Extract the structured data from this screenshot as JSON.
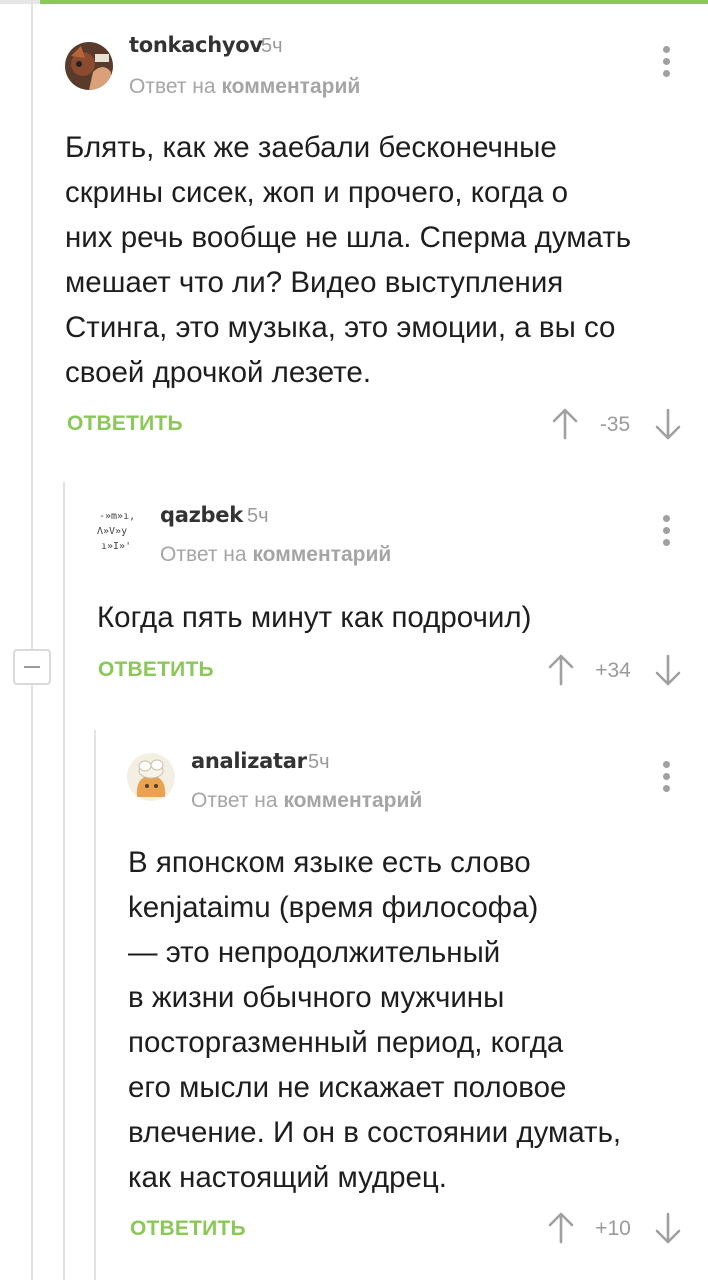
{
  "colors": {
    "accent": "#8ac858",
    "muted": "#a5a5a5",
    "text": "#1e1e1e"
  },
  "comments": [
    {
      "author": "tonkachyov",
      "time": "5ч",
      "reply_prefix": "Ответ на",
      "reply_target": "комментарий",
      "lines": [
        "Блять, как же заебали бесконечные",
        "скрины сисек, жоп и прочего, когда о",
        "них речь вообще не шла. Сперма думать",
        "мешает что ли? Видео выступления",
        "Стинга, это музыка, это эмоции, а вы со",
        "своей дрочкой лезете."
      ],
      "reply_label": "ОТВЕТИТЬ",
      "rating": "-35"
    },
    {
      "author": "qazbek",
      "time": "5ч",
      "reply_prefix": "Ответ на",
      "reply_target": "комментарий",
      "lines": [
        "Когда пять минут как подрочил)"
      ],
      "reply_label": "ОТВЕТИТЬ",
      "rating": "+34"
    },
    {
      "author": "analizatar",
      "time": "5ч",
      "reply_prefix": "Ответ на",
      "reply_target": "комментарий",
      "lines": [
        "В японском языке есть слово",
        "kenjataimu (время философа)",
        "— это непродолжительный",
        "в жизни обычного мужчины",
        "посторгазменный период, когда",
        "его мысли не искажает половое",
        "влечение. И он в состоянии думать,",
        "как настоящий мудрец."
      ],
      "reply_label": "ОТВЕТИТЬ",
      "rating": "+10"
    }
  ]
}
